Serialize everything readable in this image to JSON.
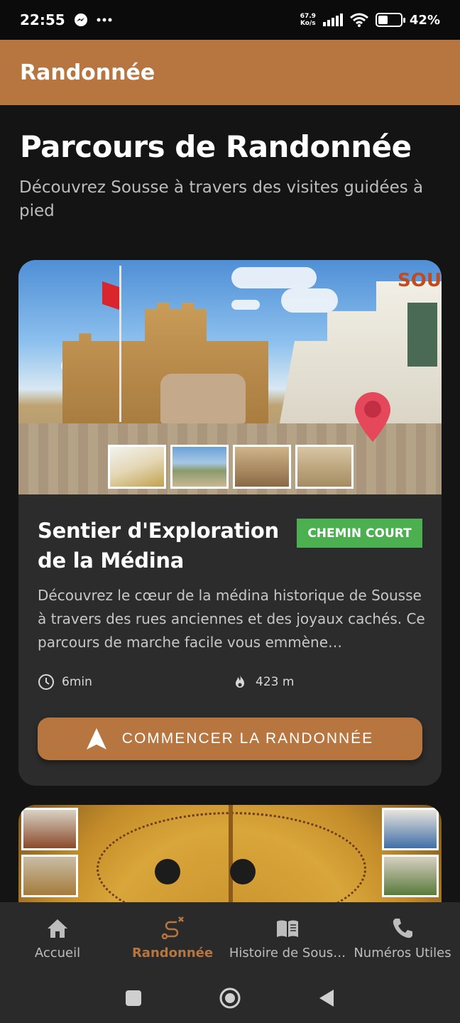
{
  "status_bar": {
    "time": "22:55",
    "net_speed_value": "67.9",
    "net_speed_unit": "Ko/s",
    "battery": "42%",
    "battery_level": 0.42,
    "icons": [
      "messenger-icon",
      "more-icon",
      "signal-icon",
      "wifi-icon",
      "battery-icon"
    ]
  },
  "app_bar": {
    "title": "Randonnée"
  },
  "page": {
    "title": "Parcours de Randonnée",
    "subtitle": "Découvrez Sousse à travers des visites guidées à pied"
  },
  "routes": [
    {
      "image_sign": "SOU",
      "title": "Sentier d'Exploration de la Médina",
      "badge": "CHEMIN COURT",
      "description": "Découvrez le cœur de la médina historique de Sousse à travers des rues anciennes et des joyaux cachés. Ce parcours de marche facile vous emmène…",
      "duration": "6min",
      "distance": "423 m",
      "button_label": "COMMENCER LA RANDONNÉE"
    }
  ],
  "bottom_nav": [
    {
      "label": "Accueil",
      "icon": "home-icon",
      "active": false
    },
    {
      "label": "Randonnée",
      "icon": "route-icon",
      "active": true
    },
    {
      "label": "Histoire de Sous…",
      "icon": "book-icon",
      "active": false
    },
    {
      "label": "Numéros Utiles",
      "icon": "phone-icon",
      "active": false
    }
  ],
  "colors": {
    "accent": "#b7763f",
    "badge_green": "#4caf50",
    "background": "#141414",
    "card": "#2c2c2c"
  }
}
